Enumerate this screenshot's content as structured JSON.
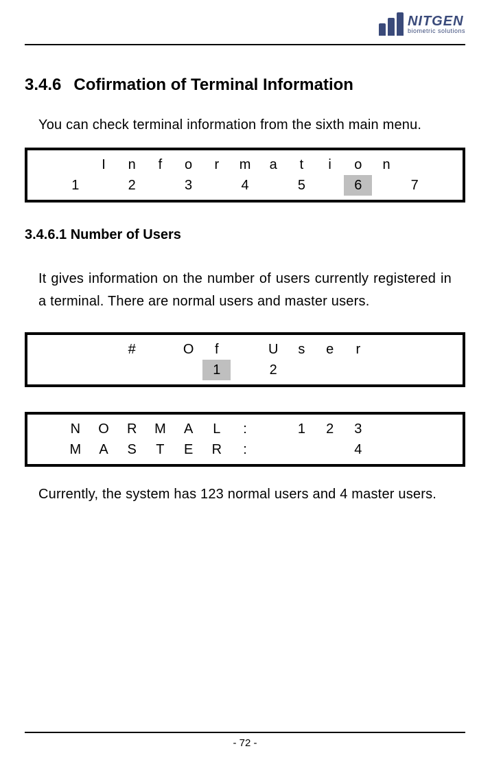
{
  "logo": {
    "name": "NITGEN",
    "tagline": "biometric solutions"
  },
  "section": {
    "number": "3.4.6",
    "title": "Cofirmation of Terminal Information"
  },
  "intro": "You can check terminal information from the sixth main menu.",
  "lcd1": {
    "row1": [
      "",
      "",
      "I",
      "n",
      "f",
      "o",
      "r",
      "m",
      "a",
      "t",
      "i",
      "o",
      "n",
      "",
      ""
    ],
    "row2": [
      "",
      "1",
      "",
      "2",
      "",
      "3",
      "",
      "4",
      "",
      "5",
      "",
      "6",
      "",
      "7",
      ""
    ],
    "highlight_col": 11
  },
  "sub": {
    "number_title": "3.4.6.1 Number of Users"
  },
  "para1": "It gives information on the number of users currently registered in a terminal. There are normal users and master users.",
  "lcd2": {
    "row1": [
      "",
      "",
      "",
      "#",
      "",
      "O",
      "f",
      "",
      "U",
      "s",
      "e",
      "r",
      "",
      "",
      ""
    ],
    "row2": [
      "",
      "",
      "",
      "",
      "",
      "",
      "1",
      "",
      "2",
      "",
      "",
      "",
      "",
      "",
      ""
    ],
    "highlight_col": 6
  },
  "lcd3": {
    "row1": [
      "",
      "N",
      "O",
      "R",
      "M",
      "A",
      "L",
      ":",
      "",
      "1",
      "2",
      "3",
      "",
      "",
      ""
    ],
    "row2": [
      "",
      "M",
      "A",
      "S",
      "T",
      "E",
      "R",
      ":",
      "",
      "",
      "",
      "4",
      "",
      "",
      ""
    ]
  },
  "para2": "Currently, the system has 123 normal users and 4 master users.",
  "page_number": "- 72 -"
}
